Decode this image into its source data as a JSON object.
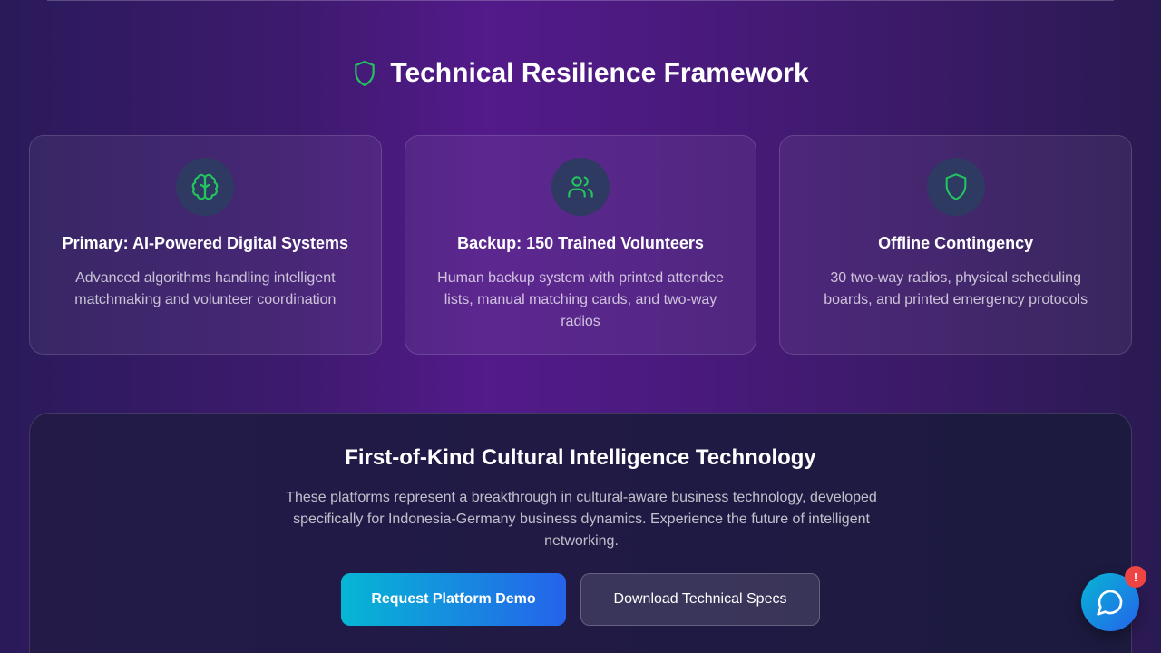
{
  "section": {
    "title": "Technical Resilience Framework",
    "title_icon": "shield-icon"
  },
  "cards": [
    {
      "icon": "brain-icon",
      "title": "Primary: AI-Powered Digital Systems",
      "description": "Advanced algorithms handling intelligent matchmaking and volunteer coordination"
    },
    {
      "icon": "users-icon",
      "title": "Backup: 150 Trained Volunteers",
      "description": "Human backup system with printed attendee lists, manual matching cards, and two-way radios"
    },
    {
      "icon": "shield-icon",
      "title": "Offline Contingency",
      "description": "30 two-way radios, physical scheduling boards, and printed emergency protocols"
    }
  ],
  "cta": {
    "title": "First-of-Kind Cultural Intelligence Technology",
    "description": "These platforms represent a breakthrough in cultural-aware business technology, developed specifically for Indonesia-Germany business dynamics. Experience the future of intelligent networking.",
    "primary_button": "Request Platform Demo",
    "secondary_button": "Download Technical Specs"
  },
  "chat": {
    "icon": "message-circle-icon",
    "badge": "!"
  },
  "colors": {
    "accent_green": "#22c55e",
    "button_gradient_start": "#06b6d4",
    "button_gradient_end": "#2563eb",
    "alert_red": "#ef4444"
  }
}
